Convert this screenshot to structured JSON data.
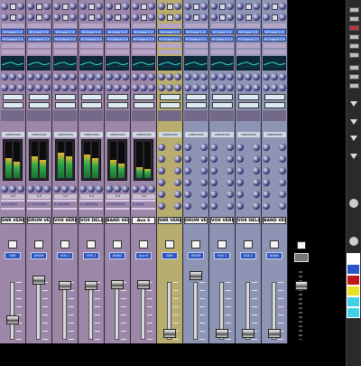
{
  "channels": [
    {
      "color": "purple",
      "input": "Hi Input 1-4",
      "output": "Hi Output 1-4",
      "mode": "sidechain",
      "name": "SNR VERB",
      "group": "SNR",
      "send_label": "A snrVerb",
      "send_value": "0.0",
      "meter": [
        0.55,
        0.45
      ],
      "fader_level": 0.27
    },
    {
      "color": "purple",
      "input": "Hi Input 1-4",
      "output": "Hi Output 1-4",
      "mode": "sidechain",
      "name": "DRUM VERB",
      "group": "DRUM",
      "send_label": "A drumVerb",
      "send_value": "0.0",
      "meter": [
        0.6,
        0.5
      ],
      "fader_level": 0.86
    },
    {
      "color": "purple",
      "input": "Hi Input 1-4",
      "output": "Hi Output 1-4",
      "mode": "sidechain",
      "name": "VOX VERB",
      "group": "VOX 1",
      "send_label": "A voxVerb",
      "send_value": "0.0",
      "meter": [
        0.7,
        0.6
      ],
      "fader_level": 0.78
    },
    {
      "color": "purple",
      "input": "Hi Input 1-4",
      "output": "Hi Output 1-4",
      "mode": "sidechain",
      "name": "VOX DELAY",
      "group": "VOX 2",
      "send_label": "A voxDelay",
      "send_value": "0.0",
      "meter": [
        0.65,
        0.55
      ],
      "fader_level": 0.78
    },
    {
      "color": "purple",
      "input": "Hi Input 1-4",
      "output": "Hi Output 1-4",
      "mode": "sidechain",
      "name": "BAND VERB",
      "group": "BAND",
      "send_label": "A bandVerb",
      "send_value": "0.0",
      "meter": [
        0.5,
        0.4
      ],
      "fader_level": 0.8
    },
    {
      "color": "purple",
      "input": "Hi Input 1-4",
      "output": "Hi Output 1-4",
      "mode": "sidechain",
      "name": "Aux 6",
      "group": "Aux 6",
      "send_label": "A aux6",
      "send_value": "0.0",
      "meter": [
        0.3,
        0.25
      ],
      "fader_level": 0.8
    },
    {
      "color": "gold",
      "input": "Hi Input 1-4",
      "output": "Hi Output 1-4",
      "mode": "sidechain",
      "name": "SNR VERB",
      "group": "SNR",
      "send_label": "",
      "send_value": "",
      "meter": [
        0.0,
        0.0
      ],
      "fader_level": 0.07
    },
    {
      "color": "blue",
      "input": "Hi Input 1-4",
      "output": "Hi Output 1-4",
      "mode": "sidechain",
      "name": "DRUM VERB",
      "group": "DRUM",
      "send_label": "",
      "send_value": "",
      "meter": [
        0.0,
        0.0
      ],
      "fader_level": 0.93
    },
    {
      "color": "blue",
      "input": "Hi Input 1-4",
      "output": "Hi Output 1-4",
      "mode": "sidechain",
      "name": "VOX VERB",
      "group": "VOX 1",
      "send_label": "",
      "send_value": "",
      "meter": [
        0.0,
        0.0
      ],
      "fader_level": 0.07
    },
    {
      "color": "blue",
      "input": "Hi Input 1-4",
      "output": "Hi Output 1-4",
      "mode": "sidechain",
      "name": "VOX DELAY",
      "group": "VOX 2",
      "send_label": "",
      "send_value": "",
      "meter": [
        0.0,
        0.0
      ],
      "fader_level": 0.07
    },
    {
      "color": "blue",
      "input": "Hi Input 1-4",
      "output": "Hi Output 1-4",
      "mode": "sidechain",
      "name": "BAND VERB",
      "group": "BAND",
      "send_label": "",
      "send_value": "",
      "meter": [
        0.0,
        0.0
      ],
      "fader_level": 0.07
    }
  ],
  "master": {
    "fader_level": 0.79
  },
  "sidebar": {
    "buttons": [
      {
        "label": "",
        "color": "#ffffff"
      },
      {
        "label": "",
        "color": "#2c56c8"
      },
      {
        "label": "",
        "color": "#c01818"
      },
      {
        "label": "",
        "color": "#e8e020"
      },
      {
        "label": "",
        "color": "#40d0e8"
      },
      {
        "label": "",
        "color": "#40d0e8"
      }
    ]
  }
}
